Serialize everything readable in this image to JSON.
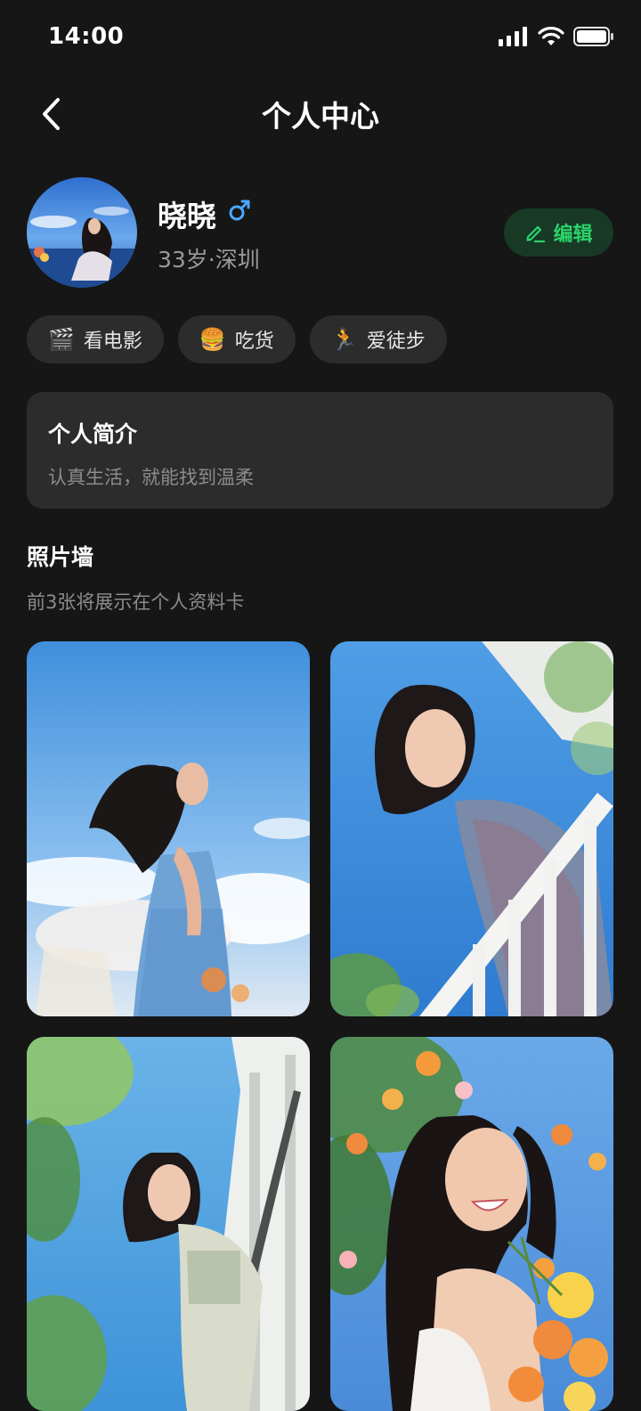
{
  "status_bar": {
    "time": "14:00",
    "icons": [
      "signal-icon",
      "wifi-icon",
      "battery-icon"
    ]
  },
  "header": {
    "title": "个人中心",
    "back_icon": "chevron-left-icon"
  },
  "profile": {
    "name": "晓晓",
    "gender_symbol": "♂",
    "meta": "33岁·深圳",
    "edit_label": "编辑",
    "edit_icon": "pencil-icon"
  },
  "tags": [
    {
      "emoji": "🎬",
      "label": "看电影"
    },
    {
      "emoji": "🍔",
      "label": "吃货"
    },
    {
      "emoji": "🏃",
      "label": "爱徒步"
    }
  ],
  "bio": {
    "title": "个人简介",
    "text": "认真生活，就能找到温柔"
  },
  "photo_wall": {
    "title": "照片墙",
    "subtitle": "前3张将展示在个人资料卡"
  },
  "colors": {
    "background": "#161616",
    "card": "#2c2c2c",
    "accent_green": "#2bd36b",
    "gender_blue": "#4aa8ff"
  }
}
